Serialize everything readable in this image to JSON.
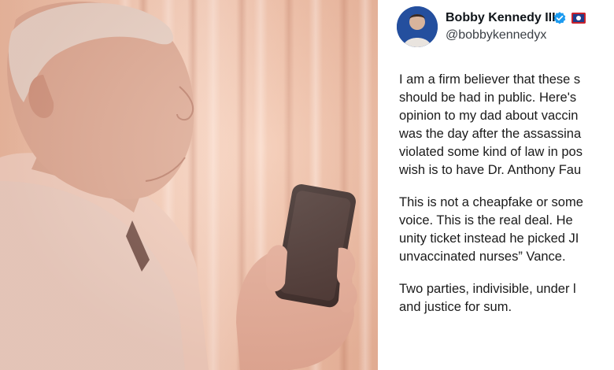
{
  "tweet": {
    "display_name": "Bobby Kennedy III",
    "handle": "@bobbykennedyx",
    "paragraphs": [
      [
        "I am a firm believer that these s",
        "should be had in public.  Here's",
        "opinion to my dad about  vaccin",
        "was the day after the assassina",
        "violated some kind of law in pos",
        "wish is to have Dr. Anthony Fau"
      ],
      [
        " This is not a cheapfake or some",
        "voice. This is the real deal.   He",
        "unity ticket instead he picked JI",
        "unvaccinated nurses” Vance."
      ],
      [
        "Two parties, indivisible,  under l",
        "and justice for sum."
      ]
    ]
  },
  "colors": {
    "verified": "#1d9bf0",
    "photo_tint": "#f3cbb5",
    "text": "#0f1419"
  },
  "icons": {
    "verified": "verified-badge-icon",
    "flag": "flag-icon"
  }
}
